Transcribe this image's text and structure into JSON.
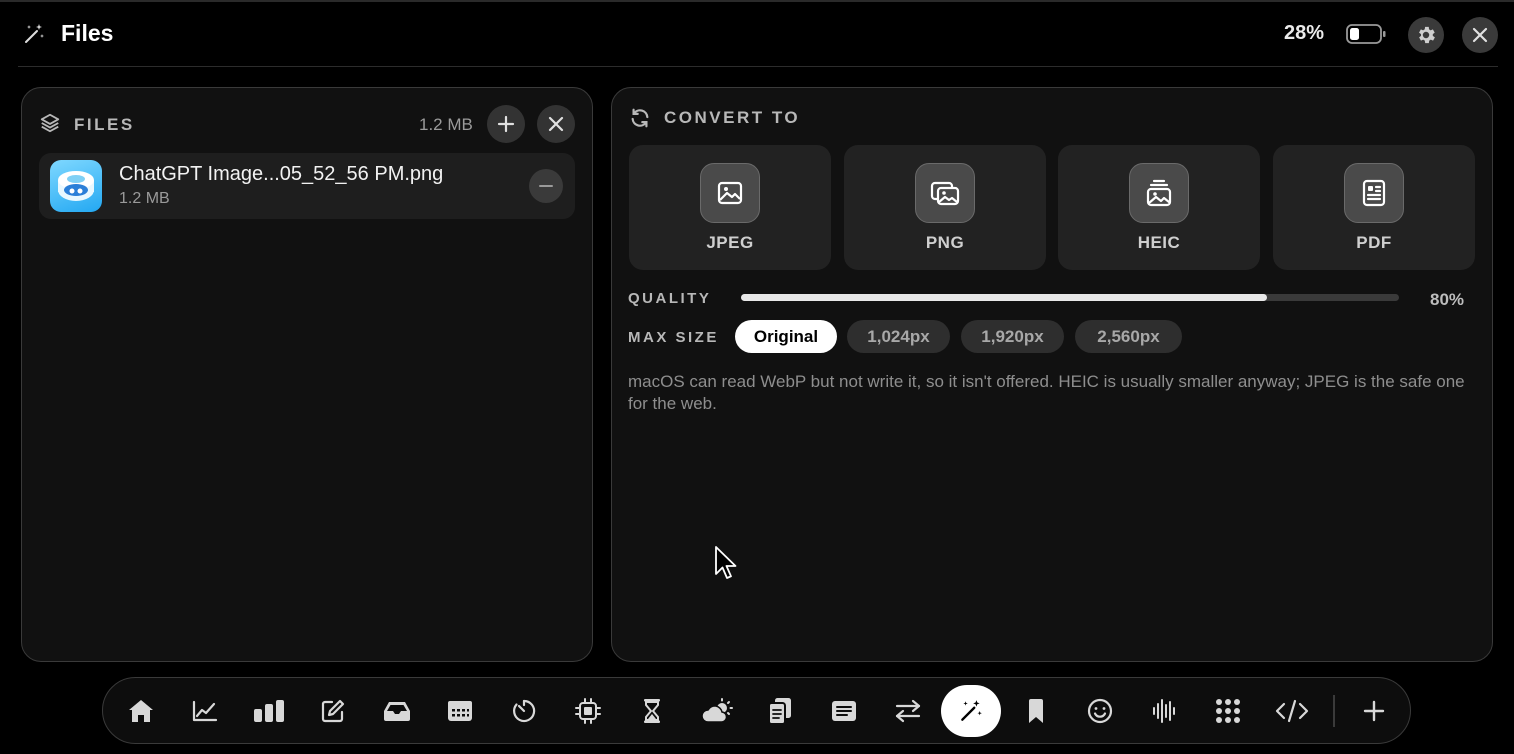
{
  "window": {
    "title": "Files",
    "title_icon": "magic-wand-icon",
    "battery_percent": "28%",
    "battery_level": 0.28
  },
  "files_panel": {
    "section_label": "FILES",
    "total_size": "1.2 MB",
    "files": [
      {
        "name": "ChatGPT Image...05_52_56 PM.png",
        "size": "1.2 MB"
      }
    ]
  },
  "convert_panel": {
    "section_label": "CONVERT TO",
    "formats": [
      {
        "label": "JPEG",
        "icon": "photo-icon"
      },
      {
        "label": "PNG",
        "icon": "photos-stack-icon"
      },
      {
        "label": "HEIC",
        "icon": "photo-layers-icon"
      },
      {
        "label": "PDF",
        "icon": "document-icon"
      }
    ],
    "quality_label": "QUALITY",
    "quality_value": "80%",
    "quality_level": 0.8,
    "max_size_label": "MAX SIZE",
    "max_size_options": [
      "Original",
      "1,024px",
      "1,920px",
      "2,560px"
    ],
    "max_size_selected": "Original",
    "note": "macOS can read WebP but not write it, so it isn't offered. HEIC is usually smaller anyway; JPEG is the safe one for the web."
  },
  "dock": {
    "items": [
      "home-icon",
      "line-chart-icon",
      "bar-chart-icon",
      "edit-icon",
      "inbox-tray-icon",
      "calendar-grid-icon",
      "timer-icon",
      "chip-icon",
      "hourglass-icon",
      "weather-icon",
      "clipboard-icon",
      "news-icon",
      "transfer-arrows-icon",
      "magic-wand-icon",
      "bookmark-icon",
      "smiley-icon",
      "waveform-icon",
      "apps-grid-icon",
      "code-icon"
    ],
    "active": "magic-wand-icon",
    "add": "plus-icon"
  }
}
